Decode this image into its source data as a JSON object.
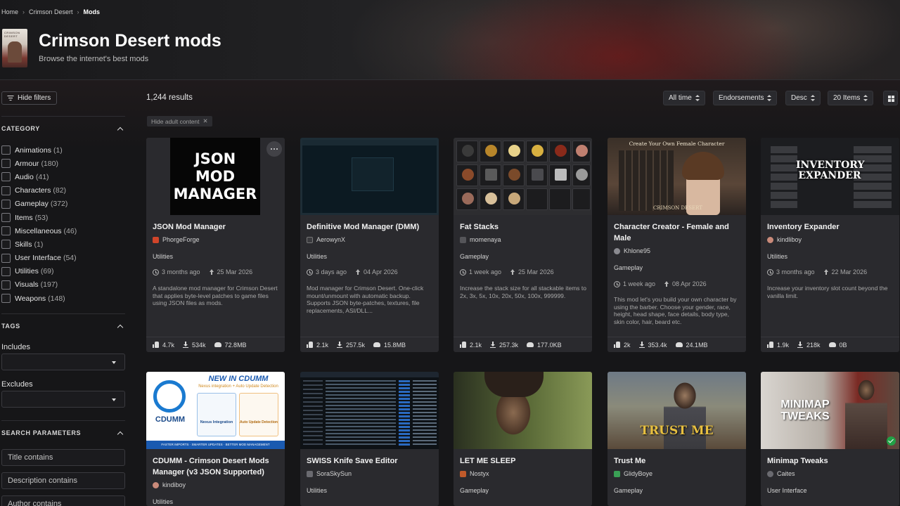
{
  "breadcrumb": {
    "home": "Home",
    "game": "Crimson Desert",
    "current": "Mods"
  },
  "header": {
    "title": "Crimson Desert mods",
    "subtitle": "Browse the internet's best mods"
  },
  "sidebar": {
    "hide_filters": "Hide filters",
    "category_heading": "CATEGORY",
    "categories": [
      {
        "name": "Animations",
        "count": "(1)"
      },
      {
        "name": "Armour",
        "count": "(180)"
      },
      {
        "name": "Audio",
        "count": "(41)"
      },
      {
        "name": "Characters",
        "count": "(82)"
      },
      {
        "name": "Gameplay",
        "count": "(372)"
      },
      {
        "name": "Items",
        "count": "(53)"
      },
      {
        "name": "Miscellaneous",
        "count": "(46)"
      },
      {
        "name": "Skills",
        "count": "(1)"
      },
      {
        "name": "User Interface",
        "count": "(54)"
      },
      {
        "name": "Utilities",
        "count": "(69)"
      },
      {
        "name": "Visuals",
        "count": "(197)"
      },
      {
        "name": "Weapons",
        "count": "(148)"
      }
    ],
    "tags_heading": "TAGS",
    "includes_label": "Includes",
    "excludes_label": "Excludes",
    "search_heading": "SEARCH PARAMETERS",
    "title_placeholder": "Title contains",
    "description_placeholder": "Description contains",
    "author_placeholder": "Author contains"
  },
  "toolbar": {
    "results": "1,244 results",
    "time": "All time",
    "sort": "Endorsements",
    "order": "Desc",
    "page_size": "20 Items",
    "adult_chip": "Hide adult content"
  },
  "cards": [
    {
      "title": "JSON Mod Manager",
      "author": "PhorgeForge",
      "avatar_color": "#d0452a",
      "category": "Utilities",
      "updated": "3 months ago",
      "uploaded": "25 Mar 2026",
      "description": "A standalone mod manager for Crimson Desert that applies byte-level patches to game files using JSON files as mods.",
      "endorsements": "4.7k",
      "downloads": "534k",
      "size": "72.8MB",
      "thumb_text": [
        "JSON",
        "MOD",
        "MANAGER"
      ]
    },
    {
      "title": "Definitive Mod Manager (DMM)",
      "author": "AerowynX",
      "avatar_color": "#3a3a3e",
      "category": "Utilities",
      "updated": "3 days ago",
      "uploaded": "04 Apr 2026",
      "description": "Mod manager for Crimson Desert. One-click mount/unmount with automatic backup. Supports JSON byte-patches, textures, file replacements, ASI/DLL...",
      "endorsements": "2.1k",
      "downloads": "257.5k",
      "size": "15.8MB"
    },
    {
      "title": "Fat Stacks",
      "author": "momenaya",
      "avatar_color": "#555559",
      "category": "Gameplay",
      "updated": "1 week ago",
      "uploaded": "25 Mar 2026",
      "description": "Increase the stack size for all stackable items to 2x, 3x, 5x, 10x, 20x, 50x, 100x, 999999.",
      "endorsements": "2.1k",
      "downloads": "257.3k",
      "size": "177.0KB"
    },
    {
      "title": "Character Creator - Female and Male",
      "author": "Khlone95",
      "avatar_color": "#8a8a90",
      "category": "Gameplay",
      "updated": "1 week ago",
      "uploaded": "08 Apr 2026",
      "description": "This mod let's you build your own character by using the barber. Choose your gender, race, height, head shape, face details, body type, skin color, hair, beard etc.",
      "endorsements": "2k",
      "downloads": "353.4k",
      "size": "24.1MB",
      "thumb_text": [
        "Create Your Own Female Character",
        "CRIMSON DESERT"
      ]
    },
    {
      "title": "Inventory Expander",
      "author": "kindliboy",
      "avatar_color": "#c98a7a",
      "category": "Utilities",
      "updated": "3 months ago",
      "uploaded": "22 Mar 2026",
      "description": "Increase your inventory slot count beyond the vanilla limit.",
      "endorsements": "1.9k",
      "downloads": "218k",
      "size": "0B",
      "thumb_text": [
        "INVENTORY",
        "EXPANDER"
      ]
    },
    {
      "title": "CDUMM - Crimson Desert Mods Manager (v3 JSON Supported)",
      "author": "kindiboy",
      "avatar_color": "#c98a7a",
      "category": "Utilities",
      "thumb_text": [
        "NEW IN CDUMM",
        "Nexus integration + Auto Update Detection",
        "CDUMM",
        "Nexus Integration",
        "Auto Update Detection",
        "FASTER IMPORTS · SMARTER UPDATES · BETTER MOD MANAGEMENT"
      ]
    },
    {
      "title": "SWISS Knife Save Editor",
      "author": "SoraSkySun",
      "avatar_color": "#6a6a70",
      "category": "Utilities"
    },
    {
      "title": "LET ME SLEEP",
      "author": "Nostyx",
      "avatar_color": "#c05a2a",
      "category": "Gameplay"
    },
    {
      "title": "Trust Me",
      "author": "GlidyBoye",
      "avatar_color": "#3aa055",
      "category": "Gameplay",
      "thumb_text": [
        "TRUST ME"
      ]
    },
    {
      "title": "Minimap Tweaks",
      "author": "Caites",
      "avatar_color": "#6a6a70",
      "category": "User Interface",
      "thumb_text": [
        "MINIMAP",
        "TWEAKS"
      ]
    }
  ]
}
